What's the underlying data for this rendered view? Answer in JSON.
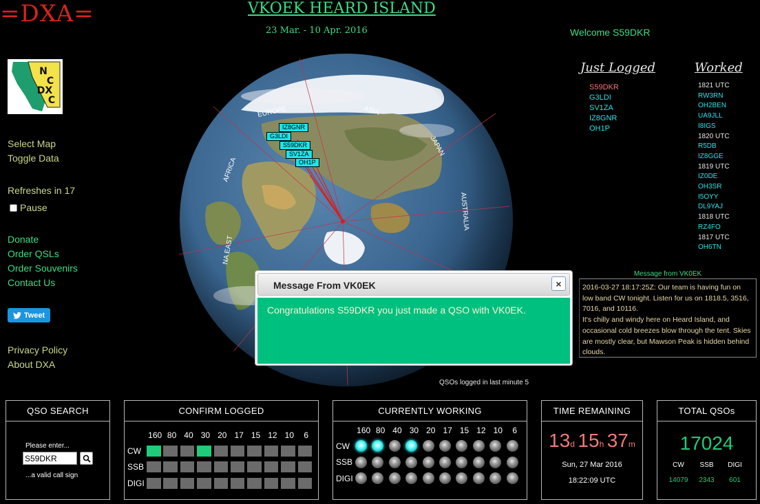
{
  "header": {
    "logo_text": "=DXA=",
    "title": "VKOEK HEARD ISLAND",
    "dates": "23 Mar. - 10 Apr. 2016",
    "welcome": "Welcome S59DKR"
  },
  "club_logo_text": "NCDXC",
  "sidebar": {
    "select_map": "Select Map",
    "toggle_data": "Toggle Data",
    "refresh_label": "Refreshes in 17",
    "pause_label": "Pause",
    "donate": "Donate",
    "order_qsls": "Order QSLs",
    "order_souvenirs": "Order Souvenirs",
    "contact_us": "Contact Us",
    "tweet": "Tweet",
    "privacy": "Privacy Policy",
    "about": "About DXA"
  },
  "map": {
    "labels": [
      "EUROPE",
      "ASIA",
      "AFRICA",
      "JAPAN",
      "AUSTRALIA",
      "NA EAST"
    ],
    "station_tags": [
      "IZ8GNR",
      "G3LDI",
      "S59DKR",
      "SV1ZA",
      "OH1P"
    ]
  },
  "just_logged": {
    "title": "Just Logged",
    "items": [
      "S59DKR",
      "G3LDI",
      "SV1ZA",
      "IZ8GNR",
      "OH1P"
    ]
  },
  "worked": {
    "title": "Worked",
    "items": [
      {
        "text": "1821 UTC",
        "kind": "time"
      },
      {
        "text": "RW3RN",
        "kind": "call"
      },
      {
        "text": "OH2BEN",
        "kind": "call"
      },
      {
        "text": "UA9JLL",
        "kind": "call"
      },
      {
        "text": "I8IGS",
        "kind": "call"
      },
      {
        "text": "1820 UTC",
        "kind": "time"
      },
      {
        "text": "R5DB",
        "kind": "call"
      },
      {
        "text": "IZ8GGE",
        "kind": "call"
      },
      {
        "text": "1819 UTC",
        "kind": "time"
      },
      {
        "text": "IZ0DE",
        "kind": "call"
      },
      {
        "text": "OH3SR",
        "kind": "call"
      },
      {
        "text": "I5OYY",
        "kind": "call"
      },
      {
        "text": "DL9YAJ",
        "kind": "call"
      },
      {
        "text": "1818 UTC",
        "kind": "time"
      },
      {
        "text": "RZ4FO",
        "kind": "call"
      },
      {
        "text": "1817 UTC",
        "kind": "time"
      },
      {
        "text": "OH6TN",
        "kind": "call"
      }
    ]
  },
  "message_panel": {
    "title": "Message from VK0EK",
    "text": "2016-03-27 18:17:25Z: Our team is having fun on low band CW tonight. Listen for us on 1818.5, 3516, 7016, and 10116.\nIt's chilly and windy here on Heard Island, and occasional cold breezes blow through the tent. Skies are mostly clear, but Mawson Peak is hidden behind clouds."
  },
  "modal": {
    "title": "Message From VK0EK",
    "close": "×",
    "body": "Congratulations S59DKR you just made a QSO with VK0EK."
  },
  "qso_minute": "QSOs logged in last minute 5",
  "qso_search": {
    "title": "QSO SEARCH",
    "label": "Please enter...",
    "value": "S59DKR",
    "hint": "...a valid call sign"
  },
  "bands": [
    "160",
    "80",
    "40",
    "30",
    "20",
    "17",
    "15",
    "12",
    "10",
    "6"
  ],
  "modes": [
    "CW",
    "SSB",
    "DIGI"
  ],
  "confirm_logged": {
    "title": "CONFIRM  LOGGED",
    "active": {
      "CW": [
        0,
        3
      ],
      "SSB": [],
      "DIGI": []
    }
  },
  "currently_working": {
    "title": "CURRENTLY   WORKING",
    "active": {
      "CW": [
        0,
        1,
        3
      ],
      "SSB": [],
      "DIGI": []
    }
  },
  "time_remaining": {
    "title": "TIME REMAINING",
    "days": "13",
    "days_unit": "d",
    "hours": "15",
    "hours_unit": "h",
    "minutes": "37",
    "minutes_unit": "m",
    "date": "Sun, 27 Mar 2016",
    "utc": "18:22:09 UTC"
  },
  "total_qsos": {
    "title": "TOTAL QSOs",
    "total": "17024",
    "labels": [
      "CW",
      "SSB",
      "DIGI"
    ],
    "values": [
      "14079",
      "2343",
      "601"
    ]
  },
  "colors": {
    "accent_green": "#3ddc84",
    "logo_red": "#d8221c",
    "cyan": "#29e3ea",
    "modal_green": "#00c080"
  }
}
